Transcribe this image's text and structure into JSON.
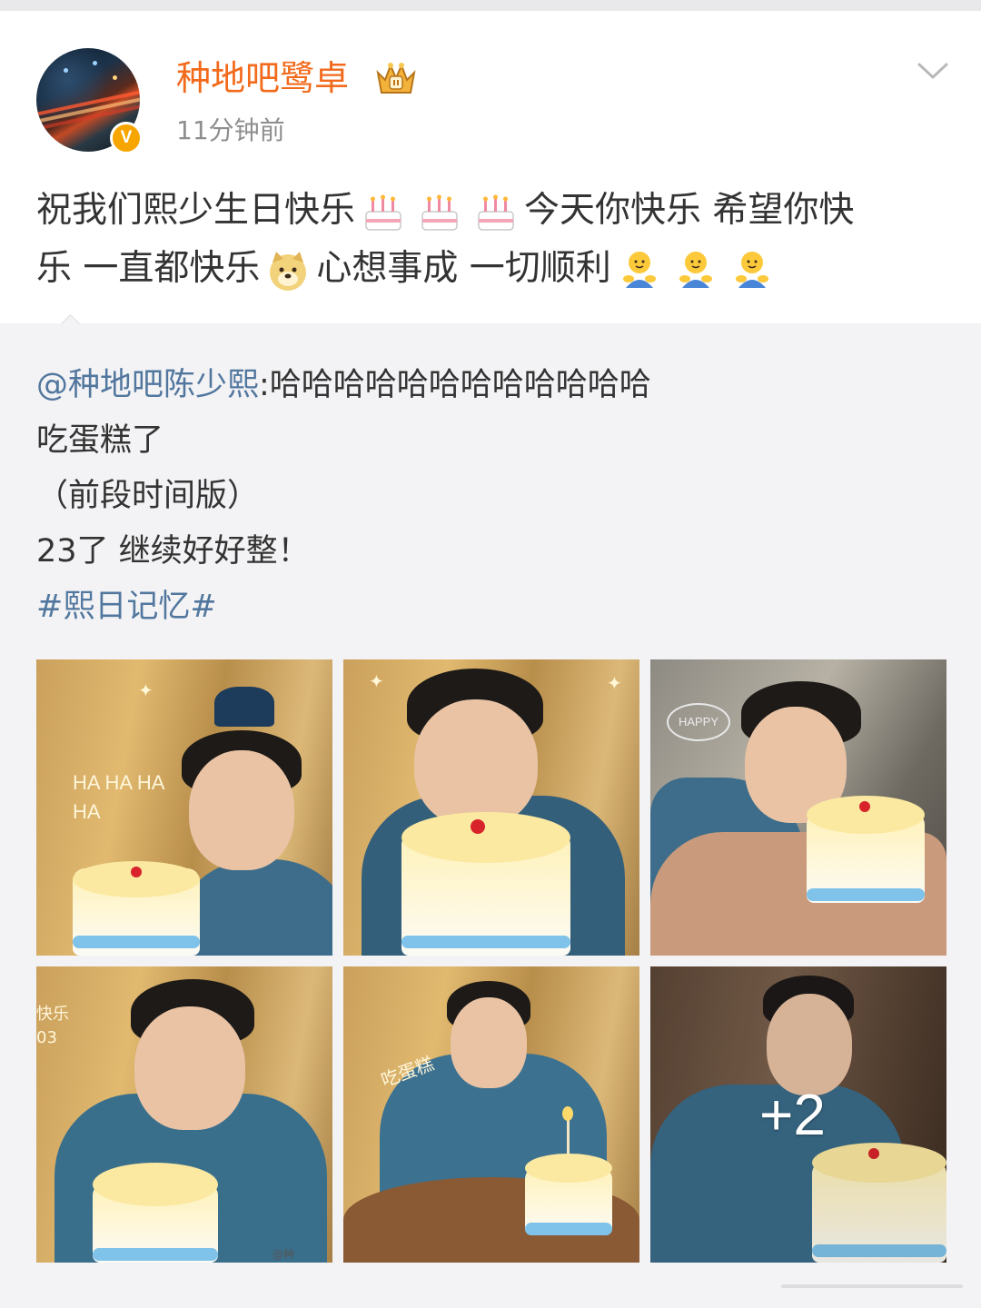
{
  "post": {
    "author": {
      "name": "种地吧鹭卓",
      "avatar_icon": "avatar-image",
      "verified_badge": "V",
      "crown_icon": "crown-icon"
    },
    "timestamp": "11分钟前",
    "text_line1": "祝我们熙少生日快乐",
    "text_line1b": "今天你快乐 希望你快",
    "text_line2a": "乐 一直都快乐",
    "text_line2b": "心想事成 一切顺利",
    "emojis": [
      "cake-emoji",
      "cake-emoji",
      "cake-emoji",
      "doge-emoji",
      "hug-emoji",
      "hug-emoji",
      "hug-emoji"
    ]
  },
  "repost": {
    "mention": "@种地吧陈少熙",
    "line1_text": ":哈哈哈哈哈哈哈哈哈哈哈哈",
    "line2": "吃蛋糕了",
    "line3": "（前段时间版）",
    "line4": "23了 继续好好整！",
    "hashtag": "#熙日记忆#",
    "images": [
      {
        "id": 1,
        "doodle": "HA HA HA HA"
      },
      {
        "id": 2,
        "doodle": ""
      },
      {
        "id": 3,
        "doodle": "HAPPY"
      },
      {
        "id": 4,
        "doodle": "快乐 03"
      },
      {
        "id": 5,
        "doodle": "吃蛋糕"
      },
      {
        "id": 6,
        "doodle": ""
      }
    ],
    "more_count": "+2",
    "watermark": "@种"
  },
  "colors": {
    "username": "#f26a1b",
    "link": "#52779e",
    "verified": "#f7a500",
    "background": "#f3f3f5"
  }
}
